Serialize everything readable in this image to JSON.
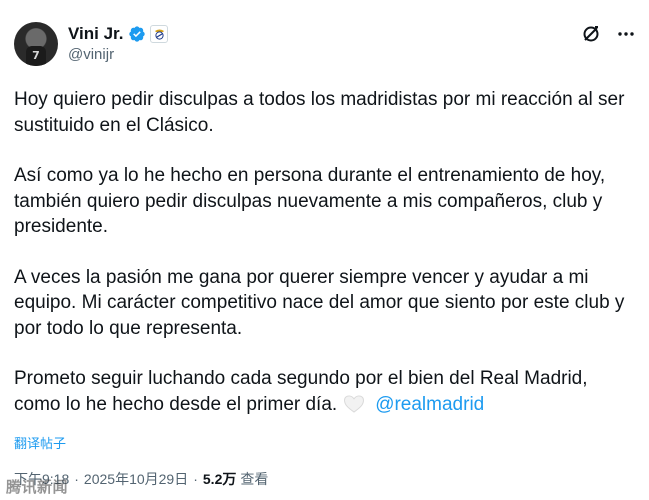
{
  "author": {
    "display_name": "Vini Jr.",
    "handle": "@vinijr",
    "avatar_jersey_number": "7"
  },
  "icons": {
    "verified": "verified-badge-icon",
    "club": "real-madrid-crest-icon",
    "grok": "grok-icon",
    "more": "more-options-icon",
    "heart": "white-heart-emoji"
  },
  "colors": {
    "accent": "#1d9bf0",
    "text": "#0f1419",
    "secondary": "#536471"
  },
  "tweet": {
    "paragraphs": [
      "Hoy quiero pedir disculpas a todos los madridistas por mi reacción al ser sustituido en el Clásico.",
      "Así como ya lo he hecho en persona durante el entrenamiento de hoy, también quiero pedir disculpas nuevamente a mis compañeros, club y presidente.",
      "A veces la pasión me gana por querer siempre vencer y ayudar a mi equipo. Mi carácter competitivo nace del amor que siento por este club y por todo lo que representa.",
      "Prometo seguir luchando cada segundo por el bien del Real Madrid, como lo he hecho desde el primer día."
    ],
    "mention": "@realmadrid",
    "translate_label": "翻译帖子"
  },
  "meta": {
    "time": "下午9:18",
    "separator": "·",
    "date": "2025年10月29日",
    "views_count": "5.2万",
    "views_label": "查看"
  },
  "watermark": "腾讯新闻"
}
